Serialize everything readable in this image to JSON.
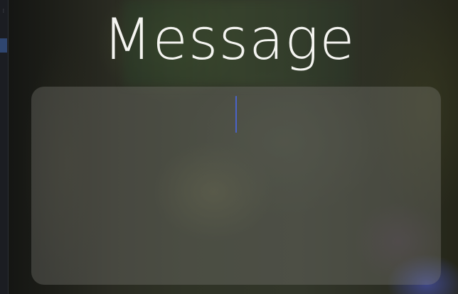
{
  "page": {
    "title": "Message"
  },
  "message_box": {
    "value": "",
    "caret_color": "#4a63c8"
  },
  "colors": {
    "title_text": "#f4f4f0",
    "box_fill": "rgba(128,128,122,0.34)",
    "sidebar_accent": "#2f4670"
  }
}
